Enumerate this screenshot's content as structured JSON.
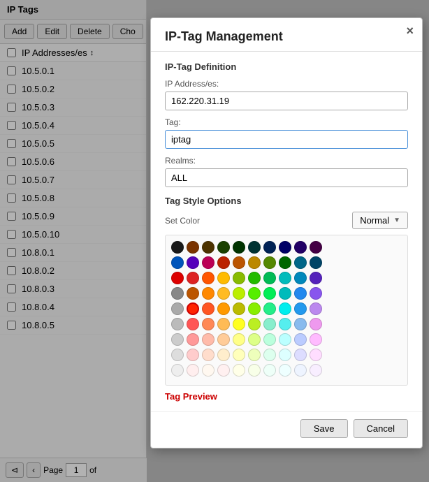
{
  "panel": {
    "title": "IP Tags",
    "buttons": [
      "Add",
      "Edit",
      "Delete",
      "Cho"
    ],
    "column_header": "IP Addresses/es",
    "rows": [
      "10.5.0.1",
      "10.5.0.2",
      "10.5.0.3",
      "10.5.0.4",
      "10.5.0.5",
      "10.5.0.6",
      "10.5.0.7",
      "10.5.0.8",
      "10.5.0.9",
      "10.5.0.10",
      "10.8.0.1",
      "10.8.0.2",
      "10.8.0.3",
      "10.8.0.4",
      "10.8.0.5"
    ],
    "pagination": {
      "page_label": "Page",
      "page_value": "1",
      "of_label": "of"
    }
  },
  "modal": {
    "title": "IP-Tag Management",
    "close_label": "×",
    "section_definition": "IP-Tag Definition",
    "ip_address_label": "IP Address/es:",
    "ip_address_value": "162.220.31.19",
    "tag_label": "Tag:",
    "tag_value": "iptag",
    "realms_label": "Realms:",
    "realms_value": "ALL",
    "style_options_label": "Tag Style Options",
    "set_color_label": "Set Color",
    "normal_label": "Normal",
    "tag_preview_label": "Tag Preview",
    "save_label": "Save",
    "cancel_label": "Cancel",
    "color_grid": [
      [
        "#1a1a1a",
        "#7a3800",
        "#4d3300",
        "#1a3300",
        "#003300",
        "#003322",
        "#002b4d",
        "#001a66",
        "#1a0066",
        "#33004d"
      ],
      [
        "#0066cc",
        "#6600cc",
        "#cc0066",
        "#cc3300",
        "#cc6600",
        "#cc9900",
        "#669900",
        "#006600",
        "#006699",
        "#005580"
      ],
      [
        "#cc0000",
        "#cc3333",
        "#ff6600",
        "#ffcc00",
        "#99cc00",
        "#33cc00",
        "#00cc66",
        "#00cccc",
        "#0099cc",
        "#6633cc"
      ],
      [
        "#999999",
        "#cc6600",
        "#ff9900",
        "#ffcc33",
        "#ccff00",
        "#66ff00",
        "#00ff66",
        "#33cccc",
        "#3399ff",
        "#9966ff"
      ],
      [
        "#aaaaaa",
        "#ff3300",
        "#ff6633",
        "#ffaa00",
        "#cccc00",
        "#99ff00",
        "#33ff99",
        "#00ffff",
        "#33aaff",
        "#cc99ff"
      ],
      [
        "#bbbbbb",
        "#ff6666",
        "#ff9966",
        "#ffcc66",
        "#ffff33",
        "#ccff33",
        "#99ffcc",
        "#66ffff",
        "#99ccff",
        "#ffaaff"
      ],
      [
        "#cccccc",
        "#ffaaaa",
        "#ffccaa",
        "#ffddaa",
        "#ffff99",
        "#eeff99",
        "#ccffee",
        "#ccffff",
        "#ccddff",
        "#ffccff"
      ],
      [
        "#dddddd",
        "#ffcccc",
        "#ffddcc",
        "#ffeedd",
        "#ffffcc",
        "#f5ffcc",
        "#eeffee",
        "#eeffff",
        "#eef0ff",
        "#fff0ff"
      ],
      [
        "#eeeeee",
        "#ffffff",
        "#f8f8f8",
        "#f0f0f0",
        "#e8e8e8",
        "#e0e0e0",
        "#d8d8d8",
        "#d0d0d0",
        "#c8c8c8",
        "#ffffff"
      ]
    ],
    "selected_color_row": 4,
    "selected_color_col": 1
  }
}
